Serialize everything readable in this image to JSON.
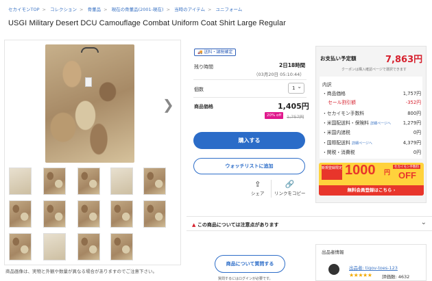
{
  "breadcrumb": [
    "セカイモンTOP",
    "コレクション",
    "骨董品",
    "現在の骨董品(2001-現在)",
    "当時のアイテム",
    "ユニフォーム"
  ],
  "title": "USGI Military Desert DCU Camouflage Combat Uniform Coat Shirt Large Regular",
  "gallery": {
    "note": "商品画像は、実物と外観や数量が異なる場合がありますのでご注意下さい。"
  },
  "purchase": {
    "badge": "送料・諸税確定",
    "remaining_label": "残り時間",
    "remaining_value": "2日18時間",
    "end_date": "（03月20日 05:10:44）",
    "qty_label": "個数",
    "qty_value": "1",
    "price_label": "商品価格",
    "price_value": "1,405円",
    "discount_badge": "20% off",
    "original_price": "1,757円",
    "buy_button": "購入する",
    "watch_button": "ウォッチリストに追加",
    "share_label": "シェア",
    "copy_link_label": "リンクをコピー"
  },
  "payment": {
    "label": "お支払い予定額",
    "total": "7,863円",
    "note": "クーポンは購入確認ページで選択できます",
    "breakdown_label": "内訳",
    "rows": [
      {
        "k": "・商品価格",
        "v": "1,757円"
      },
      {
        "k": "セール割引額",
        "v": "-352円"
      },
      {
        "k": "・セカイモン手数料",
        "v": "800円"
      },
      {
        "k": "・米国配送料・保険料",
        "link": "詳細ページへ",
        "v": "1,279円"
      },
      {
        "k": "・米国内諸税",
        "v": "0円"
      },
      {
        "k": "・国際配送料",
        "link": "詳細ページへ",
        "v": "4,379円"
      },
      {
        "k": "・関税・消費税",
        "v": "0円"
      }
    ]
  },
  "promo": {
    "tag": "新規登録限定",
    "amount": "1000",
    "yen": "円",
    "campaign": "セカイモン手数料",
    "off": "OFF",
    "cta": "無料会員登録はこちら ›"
  },
  "caution": {
    "text": "この商品については注意点があります",
    "icon": "warning-icon"
  },
  "question": {
    "button": "商品について質問する",
    "note": "質問するにはログインが必要です。"
  },
  "seller": {
    "header": "出品者情報",
    "name": "出品者: tigov-toes-123",
    "stars": "★★★★★",
    "reviews": "評価数: 4632"
  },
  "colors": {
    "accent": "#2b6cc8",
    "price_red": "#d6202d",
    "promo_yellow": "#ffd23c"
  }
}
